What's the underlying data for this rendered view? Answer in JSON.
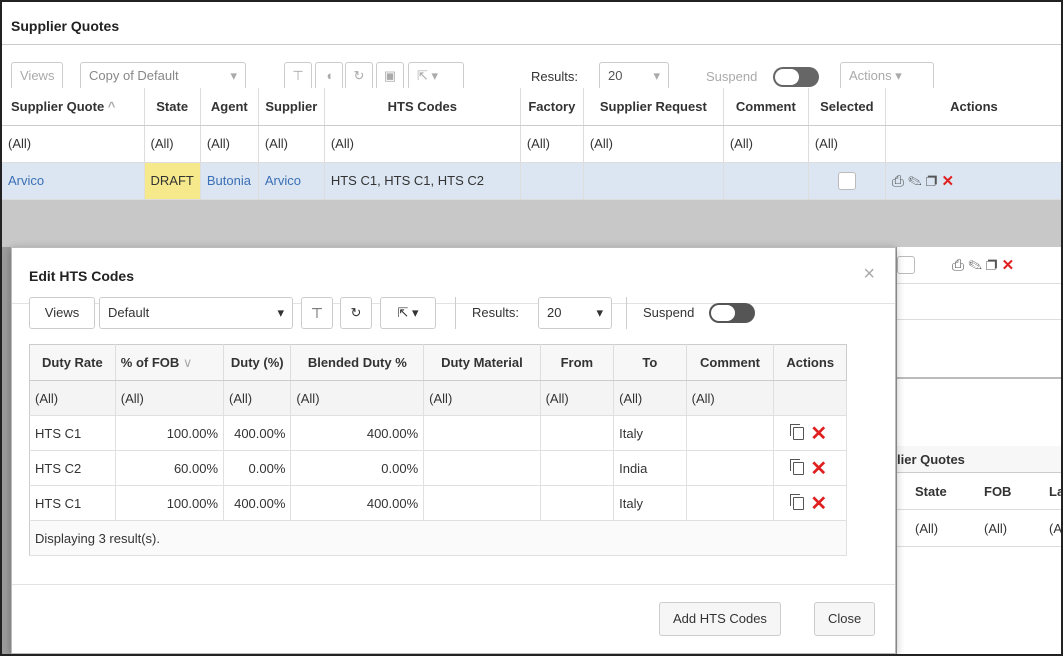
{
  "app": {
    "title": "Supplier Quotes"
  },
  "bg_toolbar": {
    "views_label": "Views",
    "view_value": "Copy of Default",
    "results_label": "Results:",
    "results_value": "20",
    "suspend_label": "Suspend",
    "actions_label": "Actions"
  },
  "bg_table": {
    "columns": [
      "Supplier Quote",
      "State",
      "Agent",
      "Supplier",
      "HTS Codes",
      "Factory",
      "Supplier Request",
      "Comment",
      "Selected",
      "Actions"
    ],
    "filter": "(All)",
    "row": {
      "quote": "Arvico",
      "state": "DRAFT",
      "agent": "Butonia",
      "supplier": "Arvico",
      "hts": "HTS C1, HTS C1, HTS C2"
    }
  },
  "bg_right": {
    "title": "lier Quotes",
    "columns": [
      "State",
      "FOB",
      "La"
    ],
    "filters": [
      "(All)",
      "(All)",
      "(A"
    ]
  },
  "modal": {
    "title": "Edit HTS Codes",
    "close_glyph": "×",
    "toolbar": {
      "views_label": "Views",
      "view_value": "Default",
      "results_label": "Results:",
      "results_value": "20",
      "suspend_label": "Suspend"
    },
    "columns": [
      "Duty Rate",
      "% of FOB",
      "Duty (%)",
      "Blended Duty %",
      "Duty Material",
      "From",
      "To",
      "Comment",
      "Actions"
    ],
    "filter": "(All)",
    "rows": [
      {
        "duty_rate": "HTS C1",
        "pct_fob": "100.00%",
        "duty": "400.00%",
        "blended": "400.00%",
        "material": "",
        "from": "",
        "to": "Italy",
        "comment": ""
      },
      {
        "duty_rate": "HTS C2",
        "pct_fob": "60.00%",
        "duty": "0.00%",
        "blended": "0.00%",
        "material": "",
        "from": "",
        "to": "India",
        "comment": ""
      },
      {
        "duty_rate": "HTS C1",
        "pct_fob": "100.00%",
        "duty": "400.00%",
        "blended": "400.00%",
        "material": "",
        "from": "",
        "to": "Italy",
        "comment": ""
      }
    ],
    "footer_text": "Displaying 3 result(s).",
    "add_button": "Add HTS Codes",
    "close_button": "Close"
  }
}
